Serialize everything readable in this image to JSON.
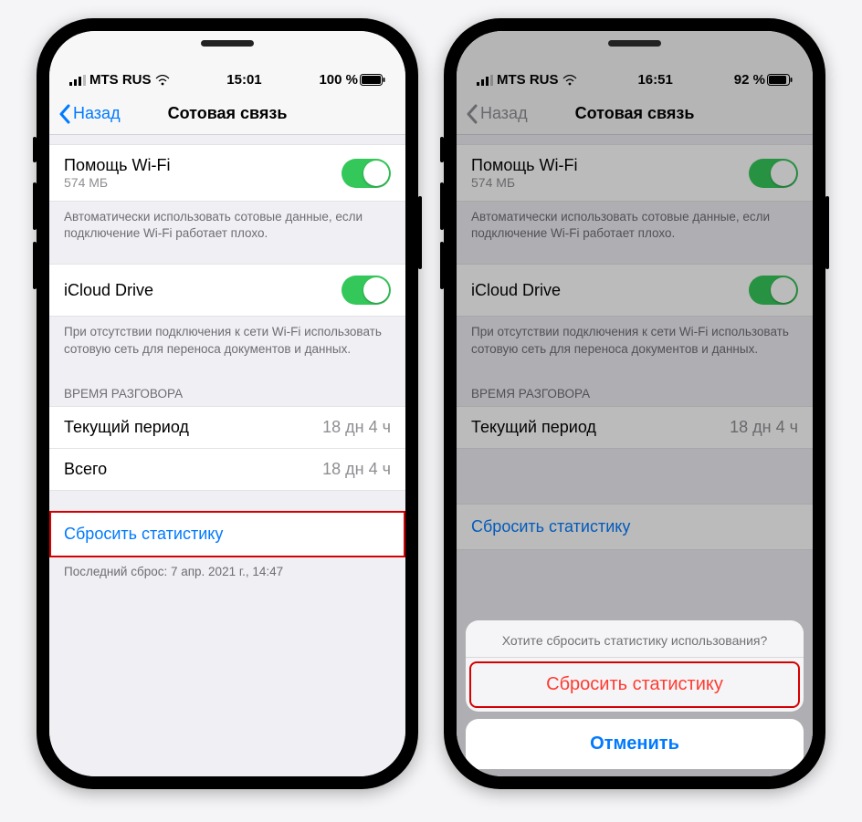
{
  "phones": [
    {
      "status": {
        "carrier": "MTS RUS",
        "time": "15:01",
        "battery": "100 %"
      },
      "nav": {
        "back": "Назад",
        "title": "Сотовая связь"
      },
      "wifi_assist": {
        "title": "Помощь Wi-Fi",
        "sub": "574 МБ",
        "footer": "Автоматически использовать сотовые данные, если подключение Wi-Fi работает плохо."
      },
      "icloud": {
        "title": "iCloud Drive",
        "footer": "При отсутствии подключения к сети Wi-Fi использовать сотовую сеть для переноса документов и данных."
      },
      "call_time": {
        "header": "ВРЕМЯ РАЗГОВОРА",
        "current_label": "Текущий период",
        "current_value": "18 дн 4 ч",
        "total_label": "Всего",
        "total_value": "18 дн 4 ч"
      },
      "reset": {
        "label": "Сбросить статистику"
      },
      "last_reset": "Последний сброс: 7 апр. 2021 г., 14:47"
    },
    {
      "status": {
        "carrier": "MTS RUS",
        "time": "16:51",
        "battery": "92 %"
      },
      "nav": {
        "back": "Назад",
        "title": "Сотовая связь"
      },
      "wifi_assist": {
        "title": "Помощь Wi-Fi",
        "sub": "574 МБ",
        "footer": "Автоматически использовать сотовые данные, если подключение Wi-Fi работает плохо."
      },
      "icloud": {
        "title": "iCloud Drive",
        "footer": "При отсутствии подключения к сети Wi-Fi использовать сотовую сеть для переноса документов и данных."
      },
      "call_time": {
        "header": "ВРЕМЯ РАЗГОВОРА",
        "current_label": "Текущий период",
        "current_value": "18 дн 4 ч"
      },
      "reset_underlay": "Сбросить статистику",
      "sheet": {
        "message": "Хотите сбросить статистику использования?",
        "reset": "Сбросить статистику",
        "cancel": "Отменить"
      }
    }
  ]
}
